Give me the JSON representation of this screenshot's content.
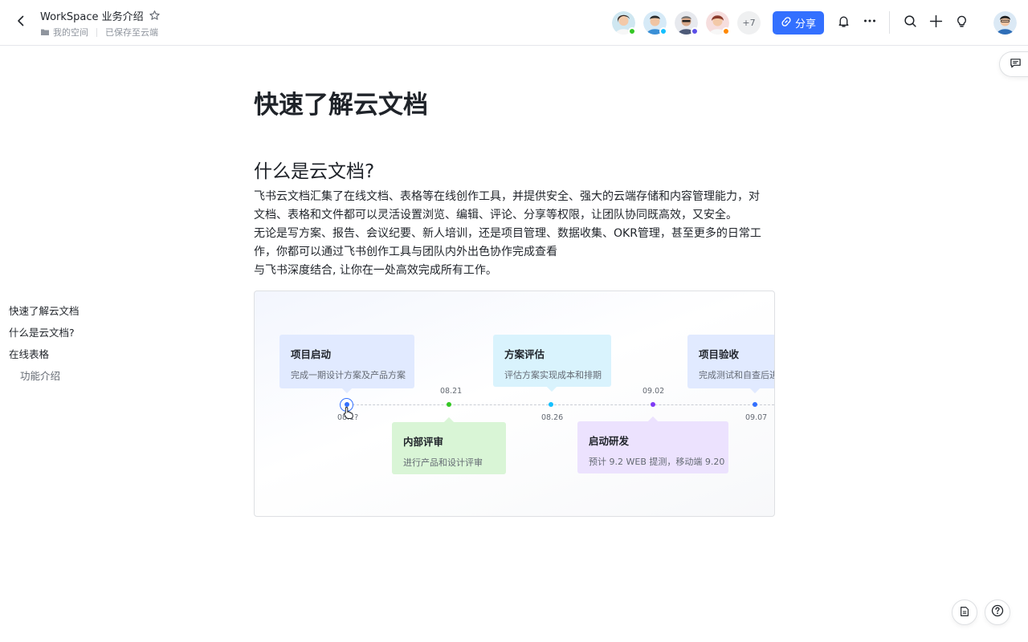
{
  "header": {
    "title": "WorkSpace 业务介绍",
    "location": "我的空间",
    "save_status": "已保存至云端",
    "collaborators_more": "+7",
    "share_label": "分享"
  },
  "outline": {
    "items": [
      {
        "label": "快速了解云文档",
        "level": 1
      },
      {
        "label": "什么是云文档?",
        "level": 1
      },
      {
        "label": "在线表格",
        "level": 1
      },
      {
        "label": "功能介绍",
        "level": 2
      }
    ]
  },
  "doc": {
    "h1": "快速了解云文档",
    "h2": "什么是云文档?",
    "lines": [
      "飞书云文档汇集了在线文档、表格等在线创作工具，并提供安全、强大的云端存储和内容管理能力，对",
      "文档、表格和文件都可以灵活设置浏览、编辑、评论、分享等权限，让团队协同既高效，又安全。",
      "无论是写方案、报告、会议纪要、新人培训，还是项目管理、数据收集、OKR管理，甚至更多的日常工",
      "作，你都可以通过飞书创作工具与团队内外出色协作完成查看",
      "与飞书深度结合, 让你在一处高效完成所有工作。"
    ]
  },
  "timeline": {
    "dates": [
      "08.1?",
      "08.21",
      "08.26",
      "09.02",
      "09.07"
    ],
    "events": [
      {
        "title": "项目启动",
        "desc": "完成一期设计方案及产品方案",
        "color": "#e1eaff"
      },
      {
        "title": "内部评审",
        "desc": "进行产品和设计评审",
        "color": "#d9f5d6"
      },
      {
        "title": "方案评估",
        "desc": "评估方案实现成本和排期",
        "color": "#d9f3fd"
      },
      {
        "title": "启动研发",
        "desc": "预计 9.2 WEB 提测，移动端 9.20",
        "color": "#ece2fe"
      },
      {
        "title": "项目验收",
        "desc": "完成测试和自查后进",
        "color": "#e1eaff"
      }
    ],
    "dot_colors": [
      "#3370ff",
      "#34c724",
      "#14c0ff",
      "#7f3bf5",
      "#3370ff"
    ]
  },
  "colors": {
    "accent": "#3370ff",
    "text": "#1f2329",
    "muted": "#8f959e"
  }
}
